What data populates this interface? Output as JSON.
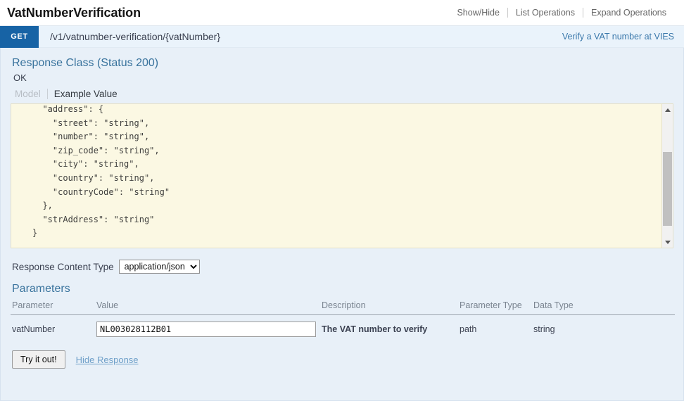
{
  "resource": {
    "title": "VatNumberVerification",
    "options": [
      {
        "label": "Show/Hide"
      },
      {
        "label": "List Operations"
      },
      {
        "label": "Expand Operations"
      }
    ]
  },
  "operation": {
    "method": "GET",
    "path": "/v1/vatnumber-verification/{vatNumber}",
    "external_link": "Verify a VAT number at VIES",
    "method_color": "#1763a5"
  },
  "response_class": {
    "heading": "Response Class (Status 200)",
    "status_text": "OK",
    "tabs": [
      {
        "label": "Model",
        "active": false
      },
      {
        "label": "Example Value",
        "active": true
      }
    ],
    "example_value": "  \"address\": {\n    \"street\": \"string\",\n    \"number\": \"string\",\n    \"zip_code\": \"string\",\n    \"city\": \"string\",\n    \"country\": \"string\",\n    \"countryCode\": \"string\"\n  },\n  \"strAddress\": \"string\"\n}"
  },
  "response_content_type": {
    "label": "Response Content Type",
    "selected": "application/json",
    "options": [
      "application/json"
    ]
  },
  "parameters": {
    "title": "Parameters",
    "columns": [
      "Parameter",
      "Value",
      "Description",
      "Parameter Type",
      "Data Type"
    ],
    "rows": [
      {
        "name": "vatNumber",
        "value": "NL003028112B01",
        "description": "The VAT number to verify",
        "param_type": "path",
        "data_type": "string"
      }
    ]
  },
  "actions": {
    "submit_label": "Try it out!",
    "toggle_response_label": "Hide Response"
  }
}
